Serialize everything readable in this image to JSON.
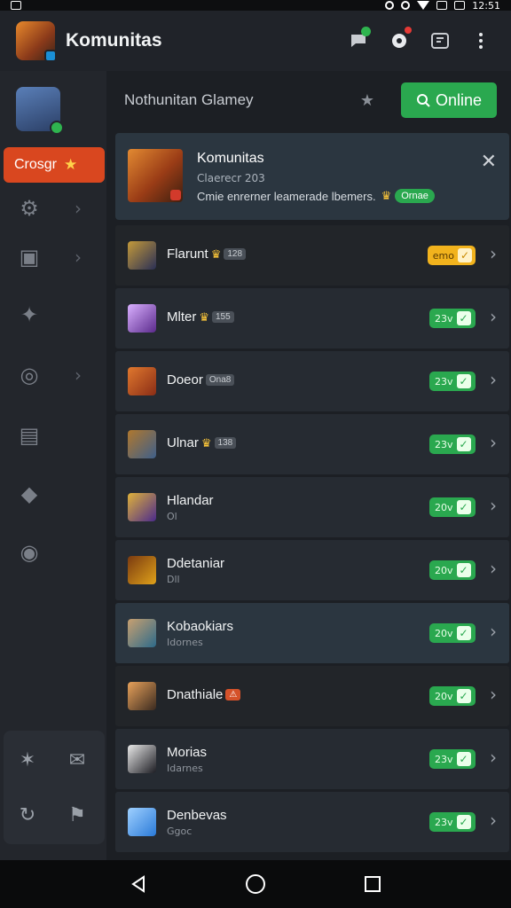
{
  "status_bar": {
    "time": "12:51"
  },
  "app_bar": {
    "title": "Komunitas"
  },
  "sidebar": {
    "pill_label": "Crosgr",
    "items": [
      {
        "icon": "gear-icon",
        "has_chevron": true
      },
      {
        "icon": "gift-icon",
        "has_chevron": true
      },
      {
        "icon": "puzzle-icon",
        "has_chevron": false
      },
      {
        "icon": "compass-icon",
        "has_chevron": true
      },
      {
        "icon": "calendar-icon",
        "has_chevron": false
      },
      {
        "icon": "chat-icon",
        "has_chevron": false
      },
      {
        "icon": "target-icon",
        "has_chevron": false
      }
    ],
    "bottom_icons": [
      "sparkle-icon",
      "mail-icon",
      "refresh-icon",
      "flag-icon"
    ]
  },
  "main_header": {
    "title": "Nothunitan Glamey",
    "online_label": "Online"
  },
  "featured": {
    "title": "Komunitas",
    "subtitle": "Claerecr 203",
    "description": "Cmie enrerner leamerade lbemers.",
    "tag": "Ornae"
  },
  "rows": [
    {
      "name": "Flarunt",
      "mini": "128",
      "sub": "",
      "badge": "emo",
      "badge_style": "yellow",
      "img": "#2a2f55",
      "img2": "#c49a3a",
      "crown": true,
      "style": "alt"
    },
    {
      "name": "Mlter",
      "mini": "155",
      "sub": "",
      "badge": "23v",
      "badge_style": "green",
      "img": "#5b2a8c",
      "img2": "#d9b0ff",
      "crown": true,
      "style": ""
    },
    {
      "name": "Doeor",
      "mini": "Ona8",
      "sub": "",
      "badge": "23v",
      "badge_style": "green",
      "img": "#8a2d16",
      "img2": "#e0782e",
      "crown": false,
      "style": ""
    },
    {
      "name": "Ulnar",
      "mini": "138",
      "sub": "",
      "badge": "23v",
      "badge_style": "green",
      "img": "#3e5f8a",
      "img2": "#b0782e",
      "crown": true,
      "style": ""
    },
    {
      "name": "Hlandar",
      "mini": "",
      "sub": "Ol",
      "badge": "20v",
      "badge_style": "green",
      "img": "#4b2a8c",
      "img2": "#e0b23a",
      "crown": false,
      "style": ""
    },
    {
      "name": "Ddetaniar",
      "mini": "",
      "sub": "Dll",
      "badge": "20v",
      "badge_style": "green",
      "img": "#e0a21a",
      "img2": "#7a3a10",
      "crown": false,
      "style": ""
    },
    {
      "name": "Kobaokiars",
      "mini": "",
      "sub": "Idornes",
      "badge": "20v",
      "badge_style": "green",
      "img": "#2d6a8a",
      "img2": "#c8a070",
      "crown": false,
      "style": "hl"
    },
    {
      "name": "Dnathiale",
      "mini": "",
      "sub": "",
      "badge": "20v",
      "badge_style": "green",
      "img": "#3a2a20",
      "img2": "#e8a25a",
      "crown": false,
      "style": "alt",
      "orange_mini": true
    },
    {
      "name": "Morias",
      "mini": "",
      "sub": "Idarnes",
      "badge": "23v",
      "badge_style": "green",
      "img": "#1c1c22",
      "img2": "#e8e8e8",
      "crown": false,
      "style": ""
    },
    {
      "name": "Denbevas",
      "mini": "",
      "sub": "Ggoc",
      "badge": "23v",
      "badge_style": "green",
      "img": "#2a7ad8",
      "img2": "#9fd0ff",
      "crown": false,
      "style": ""
    }
  ],
  "colors": {
    "accent_green": "#2aa84f",
    "accent_orange": "#d9471f",
    "badge_yellow": "#f2b31d"
  }
}
